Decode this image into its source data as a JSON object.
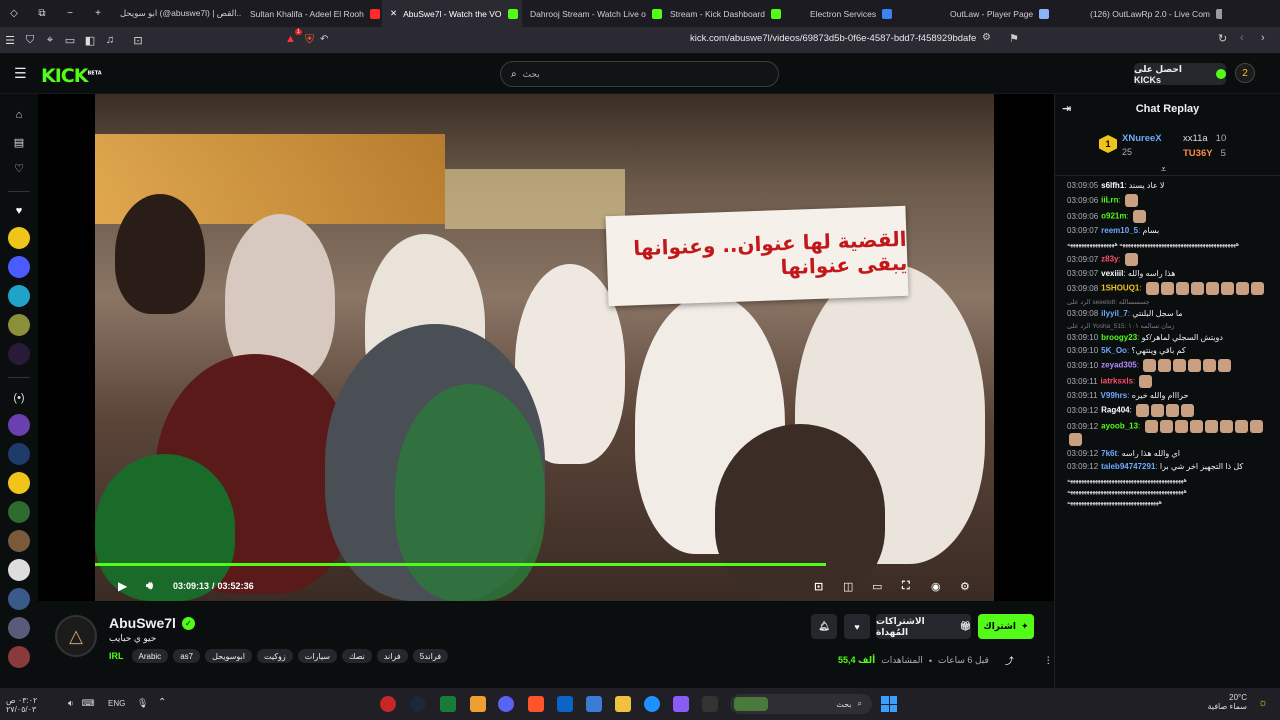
{
  "browser": {
    "tabs": [
      {
        "title": "ابو سويحل (@abuswe7l) | القص...",
        "color": "#f0c419"
      },
      {
        "title": "Sultan Khalifa - Adeel El Rooh",
        "color": "#ff2a2a"
      },
      {
        "title": "AbuSwe7l - Watch the VO",
        "color": "#53fc18",
        "active": true
      },
      {
        "title": "Dahrooj Stream - Watch Live o",
        "color": "#53fc18"
      },
      {
        "title": "Stream - Kick Dashboard",
        "color": "#53fc18"
      },
      {
        "title": "Electron Services",
        "color": "#3b82f6"
      },
      {
        "title": "OutLaw - Player Page",
        "color": "#8ab4f8"
      },
      {
        "title": "(126) OutLawRp 2.0 - Live Com",
        "color": "#9b9b9b"
      }
    ],
    "url": "kick.com/abuswe7l/videos/69873d5b-0f6e-4587-bdd7-f458929bdafe",
    "notif_badge": "1"
  },
  "header": {
    "logo": "KICK",
    "beta": "BETA",
    "search_placeholder": "بحث",
    "get_kicks": "احصل على KICKs"
  },
  "video": {
    "sign_text": "القضية لها عنوان.. وعنوانها يبقى عنوانها",
    "time_current": "03:09:13",
    "time_sep": "/",
    "time_total": "03:52:36",
    "progress": 0.813
  },
  "channel": {
    "name": "AbuSwe7l",
    "bio": "حيو ي حبايب",
    "category": "IRL",
    "tags": [
      "Arabic",
      "as7",
      "ابوسويحل",
      "زوكيت",
      "سيارات",
      "نصك",
      "فراند",
      "فراند5"
    ],
    "follow": "اشتراك",
    "gift_subs": "الاشتراكات المُهداة",
    "ago": "قبل 6 ساعات",
    "views_label": "المشاهدات",
    "views": "55,4 ألف"
  },
  "chat": {
    "title": "Chat Replay",
    "leaders": [
      {
        "rank": "1",
        "name": "XNureeX",
        "count": "25"
      },
      {
        "name": "xx11a",
        "count": "10"
      },
      {
        "name": "TU36Y",
        "count": "5"
      }
    ],
    "messages": [
      {
        "t": "03:09:05",
        "u": "s6lfh1",
        "c": "#ffffff",
        "m": "لا عاد يسند"
      },
      {
        "t": "03:09:06",
        "u": "iiLrn",
        "c": "#53fc18",
        "m": "",
        "e": 1
      },
      {
        "t": "03:09:06",
        "u": "o921m",
        "c": "#53fc18",
        "m": "",
        "e": 1
      },
      {
        "t": "03:09:07",
        "u": "reem10_5",
        "c": "#6fa8ff",
        "m": "بسام"
      },
      {
        "t": "",
        "u": "",
        "c": "#fff",
        "m": "ههههههههههههههههههههههههههههههههههههههههههه هههههههههههههههههه"
      },
      {
        "t": "03:09:07",
        "u": "z83y",
        "c": "#ff4d6a",
        "m": "",
        "e": 1
      },
      {
        "t": "03:09:07",
        "u": "vexiiil",
        "c": "#ffffff",
        "m": "هذا راسه والله"
      },
      {
        "t": "03:09:08",
        "u": "1SHOUQ1",
        "c": "#f0c419",
        "m": "",
        "e": 8
      },
      {
        "r": "الرد على seeelo8: جسسسالله"
      },
      {
        "t": "03:09:08",
        "u": "ilyyil_7",
        "c": "#6fa8ff",
        "m": "ما سجل البلنتي"
      },
      {
        "r": "الرد على Yosha_515: زمان تسالمه ١٠١"
      },
      {
        "t": "03:09:10",
        "u": "broogy23",
        "c": "#53fc18",
        "m": "دويتش السجلي لماهر/كو"
      },
      {
        "t": "03:09:10",
        "u": "5K_Oo",
        "c": "#6fa8ff",
        "m": "كم باقي وينتهي؟"
      },
      {
        "t": "03:09:10",
        "u": "zeyad305",
        "c": "#b18cff",
        "m": "",
        "e": 6
      },
      {
        "t": "03:09:11",
        "u": "iatrksxls",
        "c": "#ff4d6a",
        "m": "",
        "e": 1
      },
      {
        "t": "03:09:11",
        "u": "V99hrs",
        "c": "#6fa8ff",
        "m": "حرااام والله خيره"
      },
      {
        "t": "03:09:12",
        "u": "Rag404",
        "c": "#ffffff",
        "m": "",
        "e": 4
      },
      {
        "t": "03:09:12",
        "u": "ayoob_13",
        "c": "#53fc18",
        "m": "",
        "e": 9
      },
      {
        "t": "03:09:12",
        "u": "7k6t",
        "c": "#6fa8ff",
        "m": "اي والله هذا راسه"
      },
      {
        "t": "03:09:12",
        "u": "taleb94747291",
        "c": "#6fa8ff",
        "m": "كل ذا التجهيز اخر شي برا"
      },
      {
        "t": "",
        "u": "",
        "c": "#fff",
        "m": "ههههههههههههههههههههههههههههههههههههههههههه ههههههههههههههههههههههههههههههههههههههههههه هههههههههههههههههههههههههههههههههه"
      }
    ]
  },
  "taskbar": {
    "clock": "٠٣:٠٢ ص",
    "date": "٢٧/٠٥/٠٣",
    "lang": "ENG",
    "search": "بحث",
    "weather_temp": "20°C",
    "weather_desc": "سماء صافية"
  }
}
